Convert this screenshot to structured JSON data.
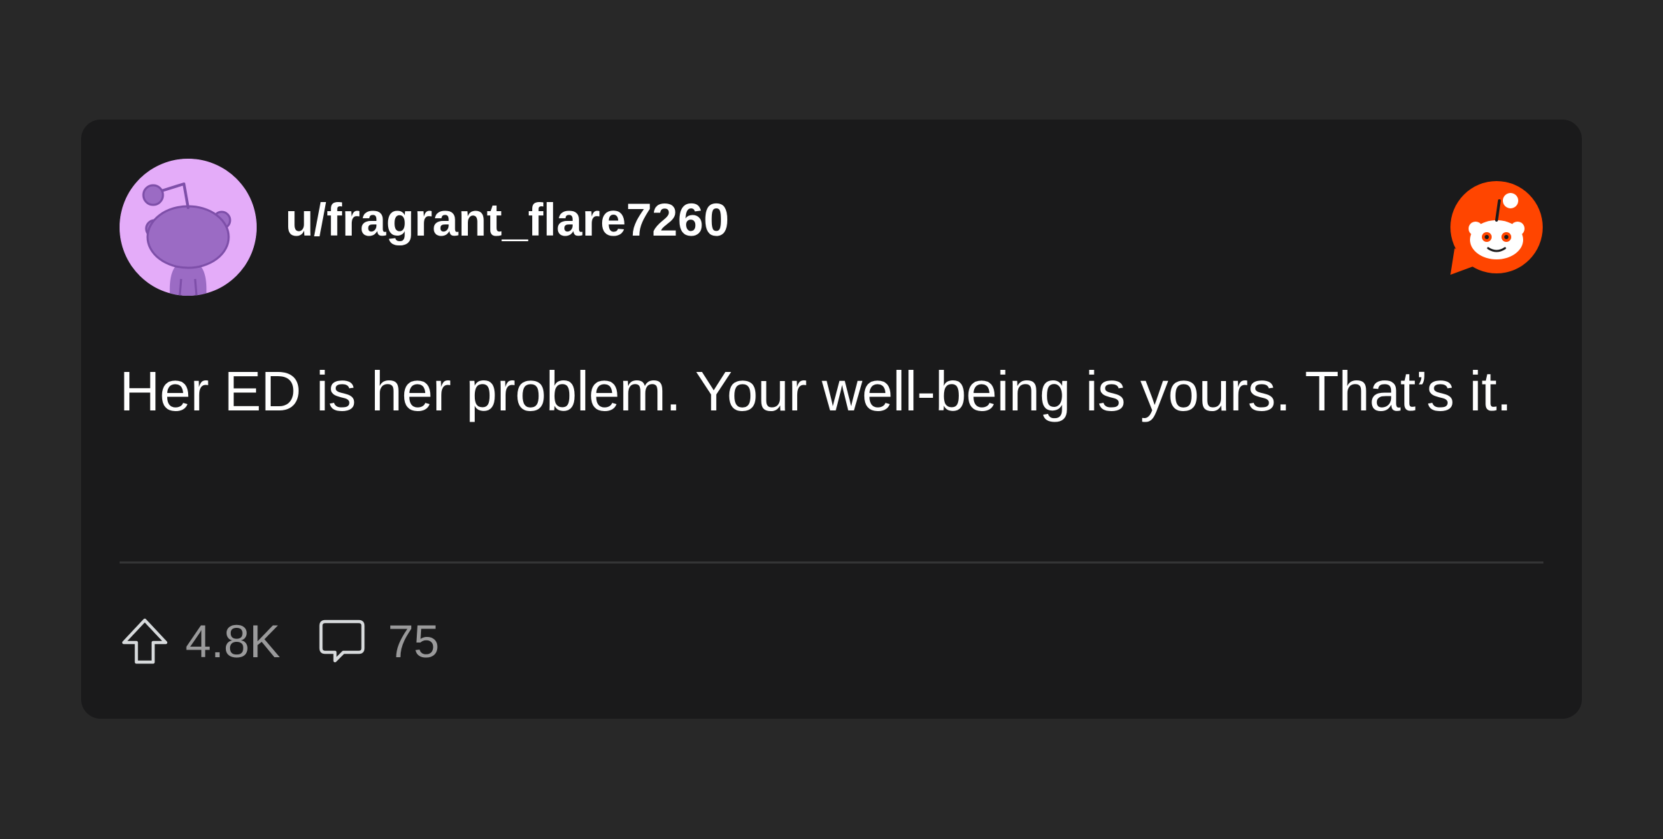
{
  "post": {
    "author": "u/fragrant_flare7260",
    "avatar_icon": "snoo-avatar-icon",
    "avatar_color": "#e4acf9",
    "brand_icon": "reddit-logo-icon",
    "brand_color": "#ff4500",
    "body": "Her ED is her problem. Your well-being is yours. That’s it."
  },
  "footer": {
    "upvote_icon": "upvote-arrow-icon",
    "upvotes": "4.8K",
    "comment_icon": "comment-bubble-icon",
    "comments": "75"
  }
}
